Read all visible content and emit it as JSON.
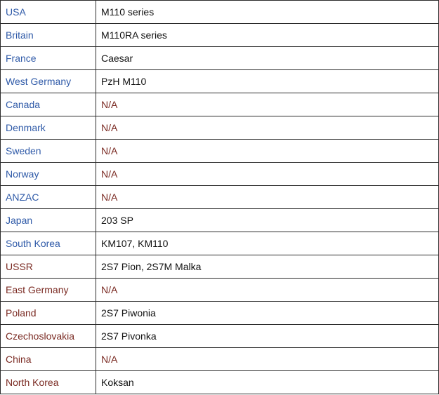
{
  "colors": {
    "blue_link": "#2f5aa8",
    "red_link": "#7a2a22",
    "text": "#111111",
    "border": "#2b2b2b"
  },
  "rows": [
    {
      "country": "USA",
      "country_color": "blue",
      "value": "M110 series",
      "value_is_link": false
    },
    {
      "country": "Britain",
      "country_color": "blue",
      "value": "M110RA series",
      "value_is_link": false
    },
    {
      "country": "France",
      "country_color": "blue",
      "value": "Caesar",
      "value_is_link": false
    },
    {
      "country": "West Germany",
      "country_color": "blue",
      "value": "PzH M110",
      "value_is_link": false
    },
    {
      "country": "Canada",
      "country_color": "blue",
      "value": "N/A",
      "value_is_link": true
    },
    {
      "country": "Denmark",
      "country_color": "blue",
      "value": "N/A",
      "value_is_link": true
    },
    {
      "country": "Sweden",
      "country_color": "blue",
      "value": "N/A",
      "value_is_link": true
    },
    {
      "country": "Norway",
      "country_color": "blue",
      "value": "N/A",
      "value_is_link": true
    },
    {
      "country": "ANZAC",
      "country_color": "blue",
      "value": "N/A",
      "value_is_link": true
    },
    {
      "country": "Japan",
      "country_color": "blue",
      "value": "203 SP",
      "value_is_link": false
    },
    {
      "country": "South Korea",
      "country_color": "blue",
      "value": "KM107, KM110",
      "value_is_link": false
    },
    {
      "country": "USSR",
      "country_color": "red",
      "value": "2S7 Pion, 2S7M Malka",
      "value_is_link": false
    },
    {
      "country": "East Germany",
      "country_color": "red",
      "value": "N/A",
      "value_is_link": true
    },
    {
      "country": "Poland",
      "country_color": "red",
      "value": "2S7 Piwonia",
      "value_is_link": false
    },
    {
      "country": "Czechoslovakia",
      "country_color": "red",
      "value": "2S7 Pivonka",
      "value_is_link": false
    },
    {
      "country": "China",
      "country_color": "red",
      "value": "N/A",
      "value_is_link": true
    },
    {
      "country": "North Korea",
      "country_color": "red",
      "value": "Koksan",
      "value_is_link": false
    }
  ]
}
